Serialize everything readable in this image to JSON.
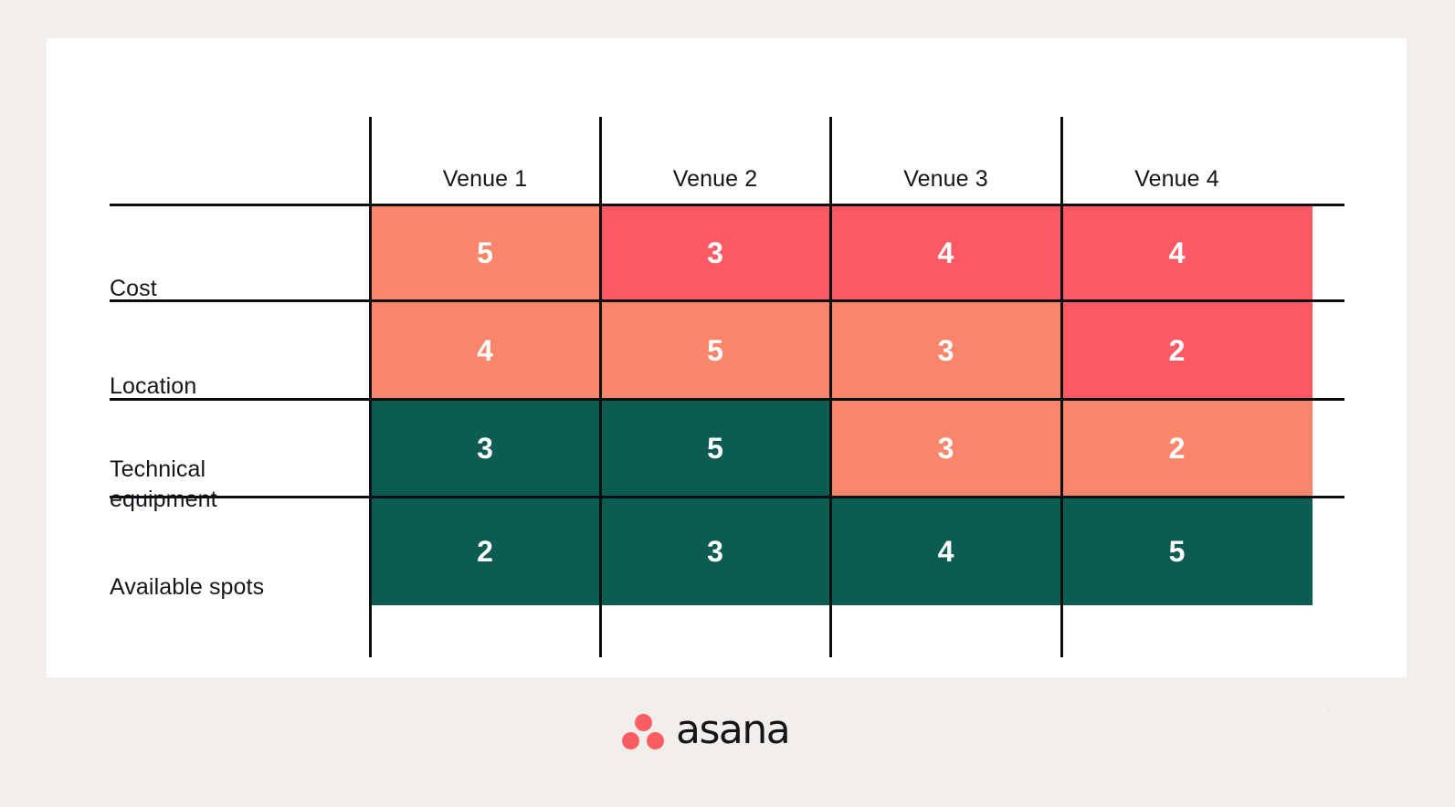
{
  "logo": {
    "wordmark": "asana",
    "dot_color": "#f95d62"
  },
  "colors": {
    "background": "#f1eeec",
    "card": "#ffffff",
    "rule": "#0d0e12",
    "text": "#15161a",
    "cell_text": "#ffffff",
    "score_low": "#fb5a65",
    "score_mid": "#f9866a",
    "score_high": "#0d5c52"
  },
  "table": {
    "corner_label": "",
    "columns": [
      "Venue 1",
      "Venue 2",
      "Venue 3",
      "Venue 4"
    ],
    "rows": [
      {
        "label": "Cost",
        "values": [
          5,
          3,
          4,
          4
        ],
        "shades": [
          "mid",
          "low",
          "low",
          "low"
        ]
      },
      {
        "label": "Location",
        "values": [
          4,
          5,
          3,
          2
        ],
        "shades": [
          "mid",
          "mid",
          "mid",
          "low"
        ]
      },
      {
        "label": "Technical equipment",
        "values": [
          3,
          5,
          3,
          2
        ],
        "shades": [
          "high",
          "high",
          "mid",
          "mid"
        ]
      },
      {
        "label": "Available spots",
        "values": [
          2,
          3,
          4,
          5
        ],
        "shades": [
          "high",
          "high",
          "high",
          "high"
        ]
      }
    ]
  },
  "chart_data": {
    "type": "heatmap",
    "title": "",
    "xlabel": "",
    "ylabel": "",
    "categories": [
      "Venue 1",
      "Venue 2",
      "Venue 3",
      "Venue 4"
    ],
    "rows": [
      "Cost",
      "Location",
      "Technical equipment",
      "Available spots"
    ],
    "series": [
      {
        "name": "Cost",
        "values": [
          5,
          3,
          4,
          4
        ]
      },
      {
        "name": "Location",
        "values": [
          4,
          5,
          3,
          2
        ]
      },
      {
        "name": "Technical equipment",
        "values": [
          3,
          5,
          3,
          2
        ]
      },
      {
        "name": "Available spots",
        "values": [
          2,
          3,
          4,
          5
        ]
      }
    ],
    "color_scale": {
      "low": "#fb5a65",
      "mid": "#f9866a",
      "high": "#0d5c52"
    },
    "cell_colors": [
      [
        "mid",
        "low",
        "low",
        "low"
      ],
      [
        "mid",
        "mid",
        "mid",
        "low"
      ],
      [
        "high",
        "high",
        "mid",
        "mid"
      ],
      [
        "high",
        "high",
        "high",
        "high"
      ]
    ],
    "value_range": [
      2,
      5
    ],
    "grid": true,
    "legend": "none"
  }
}
